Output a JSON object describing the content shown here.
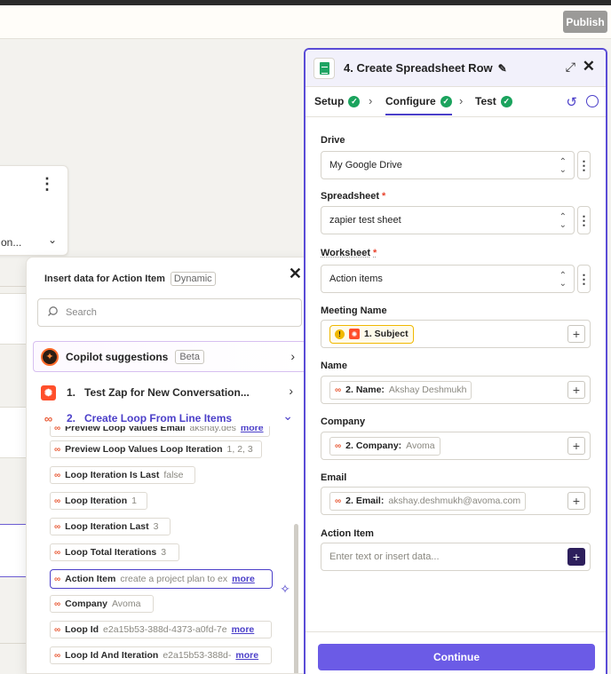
{
  "topbar": {
    "publish_label": "Publish"
  },
  "canvas": {
    "node_truncated_label": "on..."
  },
  "insert_panel": {
    "title": "Insert data for Action Item",
    "dynamic_badge": "Dynamic",
    "search_placeholder": "Search",
    "copilot_label": "Copilot suggestions",
    "copilot_badge": "Beta",
    "steps": [
      {
        "num": "1.",
        "label": "Test Zap for New Conversation..."
      },
      {
        "num": "2.",
        "label": "Create Loop From Line Items"
      }
    ],
    "items": [
      {
        "key": "Preview Loop Values Email",
        "value": "akshay.des",
        "more": "more"
      },
      {
        "key": "Preview Loop Values Loop Iteration",
        "value": "1, 2, 3"
      },
      {
        "key": "Loop Iteration Is Last",
        "value": "false"
      },
      {
        "key": "Loop Iteration",
        "value": "1"
      },
      {
        "key": "Loop Iteration Last",
        "value": "3"
      },
      {
        "key": "Loop Total Iterations",
        "value": "3"
      },
      {
        "key": "Action Item",
        "value": "create a project plan to ex",
        "more": "more"
      },
      {
        "key": "Company",
        "value": "Avoma"
      },
      {
        "key": "Loop Id",
        "value": "e2a15b53-388d-4373-a0fd-7e",
        "more": "more"
      },
      {
        "key": "Loop Id And Iteration",
        "value": "e2a15b53-388d-",
        "more": "more"
      }
    ]
  },
  "step_panel": {
    "title": "4. Create Spreadsheet Row",
    "tabs": [
      "Setup",
      "Configure",
      "Test"
    ],
    "fields": {
      "drive_label": "Drive",
      "drive_value": "My Google Drive",
      "spreadsheet_label": "Spreadsheet",
      "spreadsheet_value": "zapier test sheet",
      "worksheet_label": "Worksheet",
      "worksheet_value": "Action items",
      "meeting_name_label": "Meeting Name",
      "meeting_name_pill": "1. Subject",
      "name_label": "Name",
      "name_pill_key": "2. Name:",
      "name_pill_value": "Akshay Deshmukh",
      "company_label": "Company",
      "company_pill_key": "2. Company:",
      "company_pill_value": "Avoma",
      "email_label": "Email",
      "email_pill_key": "2. Email:",
      "email_pill_value": "akshay.deshmukh@avoma.com",
      "action_item_label": "Action Item",
      "action_item_placeholder": "Enter text or insert data...",
      "required_mark": "*"
    },
    "continue_label": "Continue"
  }
}
